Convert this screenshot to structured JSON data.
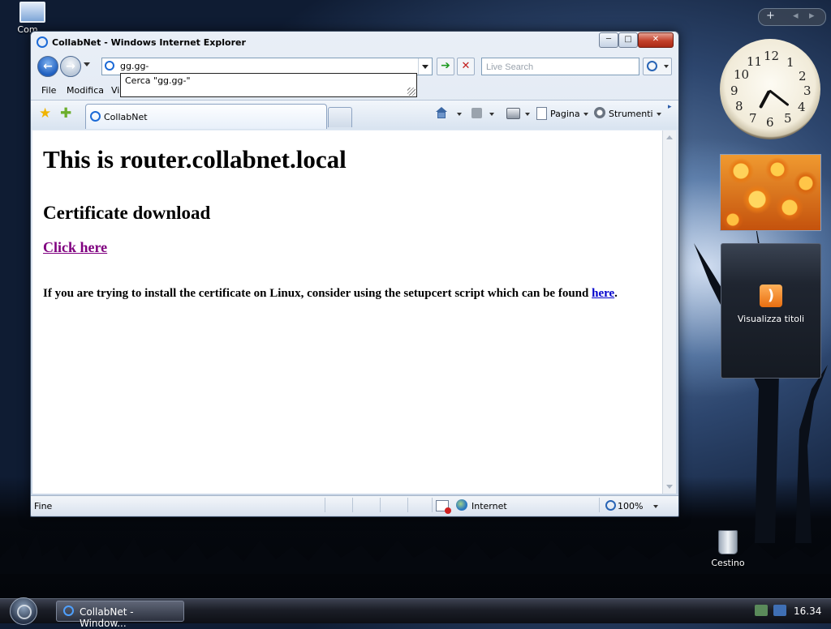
{
  "desktop": {
    "computer_icon_label": "Com",
    "recycle_bin_label": "Cestino"
  },
  "sidebar": {
    "controls": {
      "add": "+",
      "prev": "◂",
      "next": "▸"
    },
    "clock_numbers": [
      "12",
      "1",
      "2",
      "3",
      "4",
      "5",
      "6",
      "7",
      "8",
      "9",
      "10",
      "11"
    ],
    "feed_gadget_label": "Visualizza titoli"
  },
  "window": {
    "title": "CollabNet - Windows Internet Explorer",
    "controls": {
      "minimize": "─",
      "maximize": "□",
      "close": "✕"
    }
  },
  "navigation": {
    "address_value": "gg.gg-",
    "search_placeholder": "Live Search",
    "autocomplete_item": "Cerca \"gg.gg-\""
  },
  "menubar": {
    "items": [
      "File",
      "Modifica",
      "Vis"
    ]
  },
  "tabs": {
    "active_tab_label": "CollabNet"
  },
  "command_bar": {
    "page_label": "Pagina",
    "tools_label": "Strumenti"
  },
  "page": {
    "heading": "This is router.collabnet.local",
    "subheading": "Certificate download",
    "link_label": "Click here",
    "note_text": "If you are trying to install the certificate on Linux, consider using the setupcert script which can be found ",
    "note_link": "here",
    "note_end": "."
  },
  "statusbar": {
    "status": "Fine",
    "zone": "Internet",
    "zoom": "100%"
  },
  "taskbar": {
    "task_label": "CollabNet - Window...",
    "time": "16.34"
  }
}
